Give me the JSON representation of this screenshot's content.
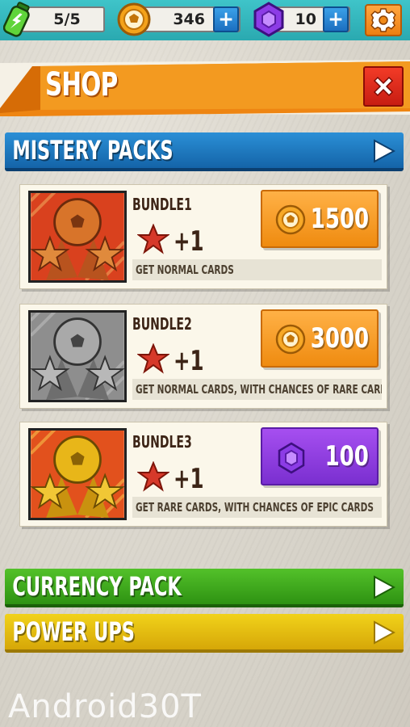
{
  "resources": {
    "energy": "5/5",
    "coins": "346",
    "gems": "10",
    "plus_label": "+"
  },
  "header": {
    "title": "SHOP",
    "close_label": "X"
  },
  "sections": {
    "mystery": "MISTERY PACKS",
    "currency": "CURRENCY PACK",
    "power": "POWER UPS"
  },
  "bundles": [
    {
      "name": "BUNDLE1",
      "bonus": "+1",
      "desc": "GET NORMAL CARDS",
      "price": "1500",
      "currency": "coin",
      "ball_color": "#d8742a"
    },
    {
      "name": "BUNDLE2",
      "bonus": "+1",
      "desc": "GET NORMAL CARDS, WITH CHANCES OF RARE CARDS",
      "price": "3000",
      "currency": "coin",
      "ball_color": "#8a8a8a"
    },
    {
      "name": "BUNDLE3",
      "bonus": "+1",
      "desc": "GET RARE CARDS, WITH CHANCES OF EPIC CARDS",
      "price": "100",
      "currency": "gem",
      "ball_color": "#e8b619"
    }
  ],
  "watermark": "Android30T",
  "colors": {
    "topbar": "#2fb3b9",
    "shop_orange": "#f28b16",
    "mystery_blue": "#1f7cc4",
    "currency_green": "#3fa81c",
    "power_yellow": "#e6bb10",
    "close_red": "#dc2c1c",
    "gem_purple": "#8b3ce0"
  }
}
